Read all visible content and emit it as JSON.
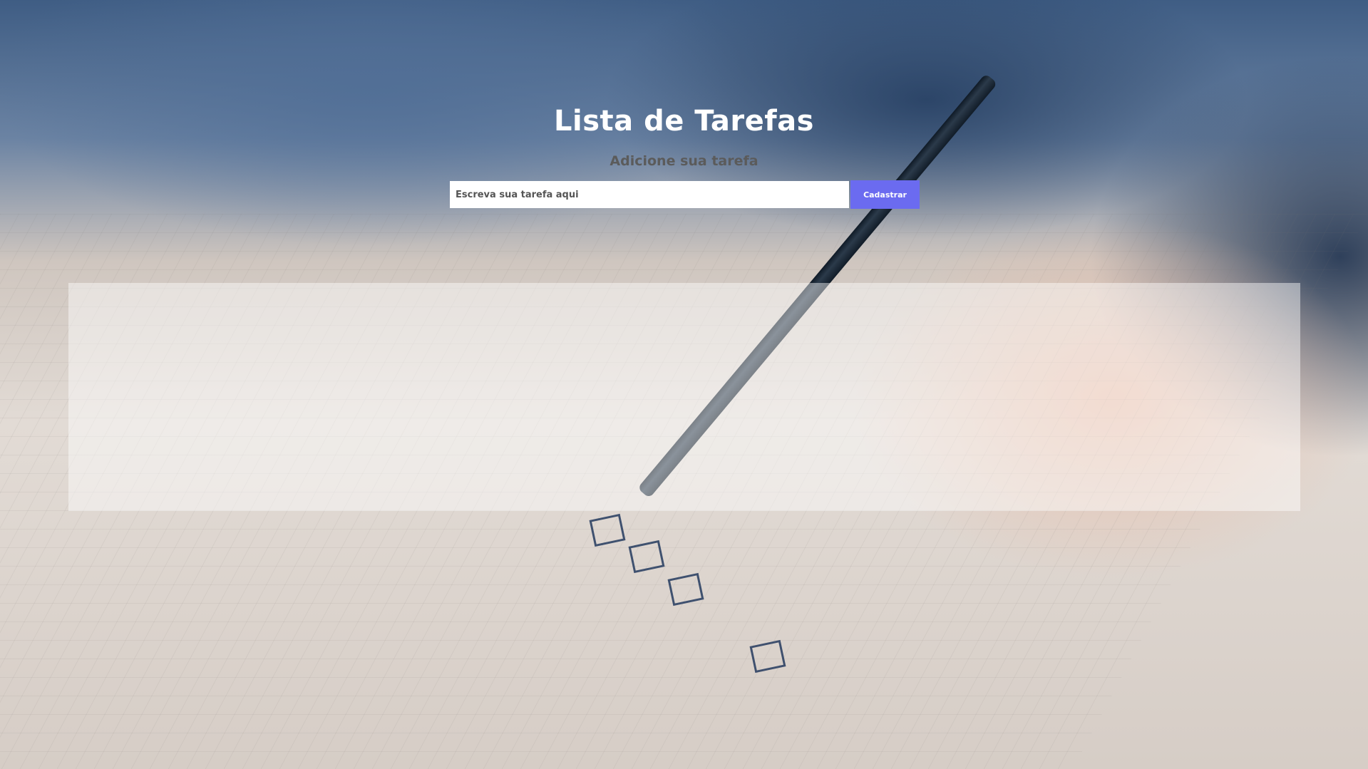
{
  "header": {
    "title": "Lista de Tarefas",
    "subtitle": "Adicione sua tarefa"
  },
  "form": {
    "input_value": "",
    "input_placeholder": "Escreva sua tarefa aqui",
    "submit_label": "Cadastrar"
  },
  "task_list": {
    "items": []
  },
  "colors": {
    "accent": "#6b6bf0",
    "title": "#ffffff",
    "subtitle": "#5b5b5b"
  }
}
